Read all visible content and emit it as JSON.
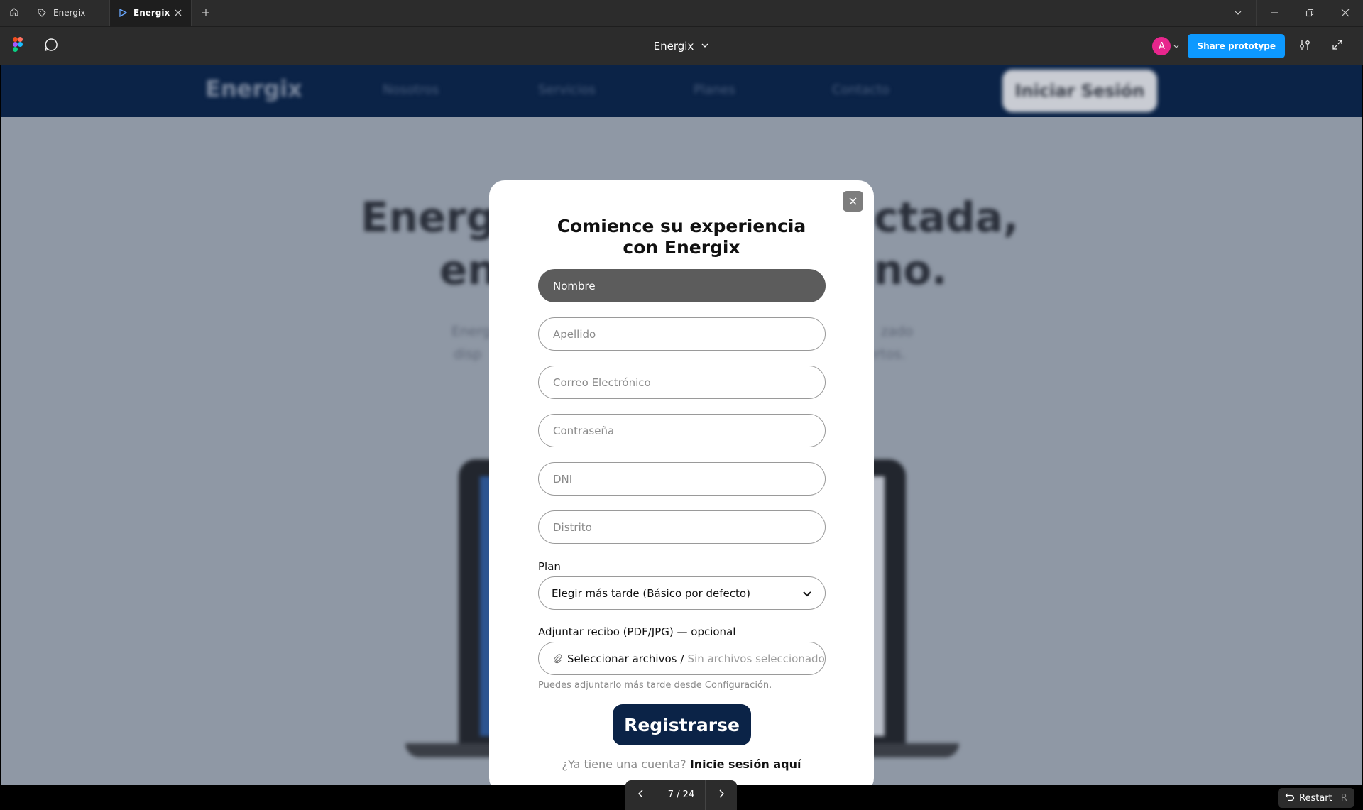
{
  "window": {
    "tabs": [
      {
        "label": "Energix",
        "active": false
      },
      {
        "label": "Energix",
        "active": true
      }
    ]
  },
  "toolbar": {
    "file_title": "Energix",
    "avatar_initial": "A",
    "share_label": "Share prototype"
  },
  "site": {
    "logo": "Energix",
    "nav_links": [
      "Nosotros",
      "Servicios",
      "Planes",
      "Contacto"
    ],
    "nav_cta": "Iniciar Sesión",
    "hero_line1_left": "Energí",
    "hero_line1_right": "ctada,",
    "hero_line2_left": "en",
    "hero_line2_right": "no.",
    "hero_sub1_left": "Energ",
    "hero_sub1_right": "zado",
    "hero_sub2_left": "disp",
    "hero_sub2_right": "ertos."
  },
  "modal": {
    "title_line1": "Comience su experiencia",
    "title_line2": "con Energix",
    "fields": {
      "nombre": "Nombre",
      "apellido": "Apellido",
      "correo": "Correo Electrónico",
      "contrasena": "Contraseña",
      "dni": "DNI",
      "distrito": "Distrito"
    },
    "plan_label": "Plan",
    "plan_value": "Elegir más tarde (Básico por defecto)",
    "file_label": "Adjuntar recibo (PDF/JPG) — opcional",
    "file_button": "Seleccionar archivos",
    "file_separator": "/",
    "file_status": "Sin archivos seleccionados",
    "file_hint": "Puedes adjuntarlo más tarde desde Configuración.",
    "register_label": "Registrarse",
    "login_prompt": "¿Ya tiene una cuenta?",
    "login_link": "Inicie sesión aquí"
  },
  "footer": {
    "page_indicator": "7 / 24",
    "restart_label": "Restart",
    "restart_key": "R"
  },
  "colors": {
    "accent": "#0d99ff",
    "brand_navy": "#0b2347",
    "avatar": "#e8268d"
  }
}
